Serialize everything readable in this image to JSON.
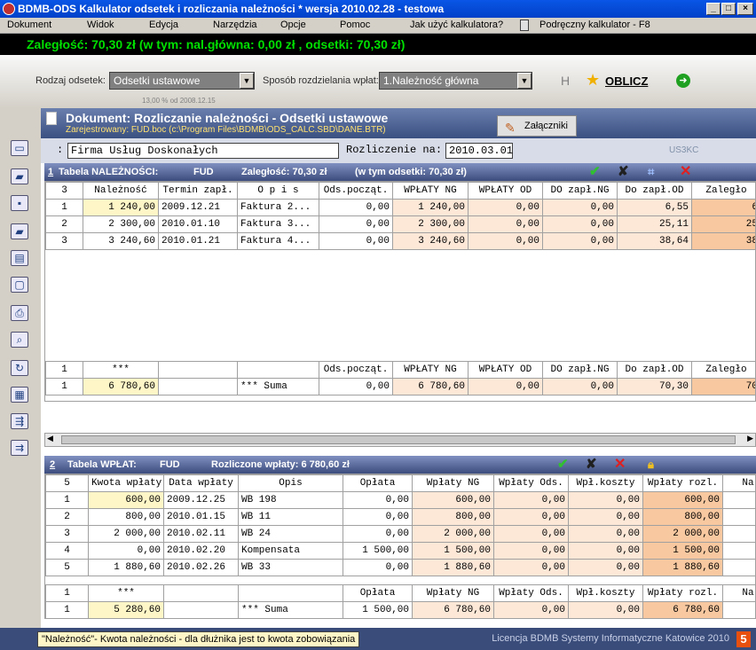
{
  "window": {
    "title": "BDMB-ODS  Kalkulator odsetek i rozliczania należności *  wersja 2010.02.28 - testowa"
  },
  "menu": [
    "Dokument",
    "Widok",
    "Edycja",
    "Narzędzia",
    "Opcje",
    "Pomoc",
    "Jak użyć kalkulatora?",
    "Podręczny kalkulator - F8"
  ],
  "status": {
    "text": "Zaległość: 70,30 zł    (w tym:  nal.główna: 0,00 zł ,  odsetki: 70,30 zł)"
  },
  "toolbar": {
    "rodzaj_label": "Rodzaj odsetek:",
    "rodzaj_value": "Odsetki ustawowe",
    "rodzaj_note": "13,00 % od 2008.12.15",
    "sposob_label": "Sposób rozdzielania wpłat:",
    "sposob_value": "1.Należność główna",
    "h_label": "H",
    "oblicz_label": "OBLICZ"
  },
  "document": {
    "title": "Dokument: Rozliczanie należności - Odsetki ustawowe",
    "registered": "Zarejestrowany: FUD.boc (c:\\Program Files\\BDMB\\ODS_CALC.SBD\\DANE.BTR)",
    "attach_label": "Załączniki",
    "colon": ":",
    "company": "Firma Usług Doskonałych",
    "rozliczenie_label": "Rozliczenie na:",
    "rozliczenie_value": "2010.03.01",
    "code": "US3KC"
  },
  "table1": {
    "bar": {
      "num": "1",
      "title": "Tabela NALEŻNOŚCI:",
      "code": "FUD",
      "zaleglosc": "Zaległość: 70,30 zł",
      "odsetki": "(w tym odsetki: 70,30 zł)"
    },
    "count": "3",
    "headers": [
      "Należność",
      "Termin zapł.",
      "O p i s",
      "Ods.począt.",
      "WPŁATY NG",
      "WPŁATY OD",
      "DO zapł.NG",
      "Do zapł.OD",
      "Zaległo"
    ],
    "rows": [
      [
        "1",
        "1 240,00",
        "2009.12.21",
        "Faktura 2...",
        "0,00",
        "1 240,00",
        "0,00",
        "0,00",
        "6,55",
        "6"
      ],
      [
        "2",
        "2 300,00",
        "2010.01.10",
        "Faktura 3...",
        "0,00",
        "2 300,00",
        "0,00",
        "0,00",
        "25,11",
        "25"
      ],
      [
        "3",
        "3 240,60",
        "2010.01.21",
        "Faktura 4...",
        "0,00",
        "3 240,60",
        "0,00",
        "0,00",
        "38,64",
        "38"
      ]
    ],
    "sum_headers": [
      "1",
      "***",
      "",
      "",
      "Ods.począt.",
      "WPŁATY NG",
      "WPŁATY OD",
      "DO zapł.NG",
      "Do zapł.OD",
      "Zaległo"
    ],
    "sum_row": [
      "1",
      "6 780,60",
      "",
      "*** Suma",
      "0,00",
      "6 780,60",
      "0,00",
      "0,00",
      "70,30",
      "70"
    ]
  },
  "table2": {
    "bar": {
      "num": "2",
      "title": "Tabela WPŁAT:",
      "code": "FUD",
      "rozliczone": "Rozliczone wpłaty: 6 780,60 zł"
    },
    "count": "5",
    "headers": [
      "Kwota wpłaty",
      "Data wpłaty",
      "Opis",
      "Opłata",
      "Wpłaty  NG",
      "Wpłaty Ods.",
      "Wpł.koszty",
      "Wpłaty rozl.",
      "Na"
    ],
    "rows": [
      [
        "1",
        "600,00",
        "2009.12.25",
        "WB 198",
        "0,00",
        "600,00",
        "0,00",
        "0,00",
        "600,00",
        ""
      ],
      [
        "2",
        "800,00",
        "2010.01.15",
        "WB 11",
        "0,00",
        "800,00",
        "0,00",
        "0,00",
        "800,00",
        ""
      ],
      [
        "3",
        "2 000,00",
        "2010.02.11",
        "WB 24",
        "0,00",
        "2 000,00",
        "0,00",
        "0,00",
        "2 000,00",
        ""
      ],
      [
        "4",
        "0,00",
        "2010.02.20",
        "Kompensata",
        "1 500,00",
        "1 500,00",
        "0,00",
        "0,00",
        "1 500,00",
        ""
      ],
      [
        "5",
        "1 880,60",
        "2010.02.26",
        "WB 33",
        "0,00",
        "1 880,60",
        "0,00",
        "0,00",
        "1 880,60",
        ""
      ]
    ],
    "sum_headers": [
      "1",
      "***",
      "",
      "",
      "Opłata",
      "Wpłaty  NG",
      "Wpłaty Ods.",
      "Wpł.koszty",
      "Wpłaty rozl.",
      "Na"
    ],
    "sum_row": [
      "1",
      "5 280,60",
      "",
      "*** Suma",
      "1 500,00",
      "6 780,60",
      "0,00",
      "0,00",
      "6 780,60",
      ""
    ]
  },
  "footer": {
    "hint": "\"Należność\"- Kwota należności - dla dłużnika jest to kwota zobowiązania",
    "license": "Licencja  BDMB Systemy Informatyczne Katowice 2010",
    "badge": "5"
  },
  "colors": {
    "accent": "#3a4c7a",
    "status_green": "#00e000",
    "highlight": "#fff6c8"
  }
}
